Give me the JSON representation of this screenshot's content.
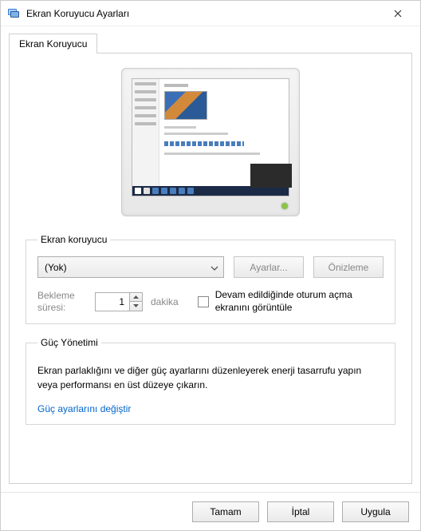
{
  "window": {
    "title": "Ekran Koruyucu Ayarları"
  },
  "tab": {
    "label": "Ekran Koruyucu"
  },
  "screensaver_group": {
    "legend": "Ekran koruyucu",
    "selected": "(Yok)",
    "settings_button": "Ayarlar...",
    "preview_button": "Önizleme"
  },
  "wait": {
    "label": "Bekleme süresi:",
    "value": "1",
    "unit": "dakika",
    "resume_label": "Devam edildiğinde oturum açma ekranını görüntüle"
  },
  "power_group": {
    "legend": "Güç Yönetimi",
    "description": "Ekran parlaklığını ve diğer güç ayarlarını düzenleyerek enerji tasarrufu yapın veya performansı en üst düzeye çıkarın.",
    "link": "Güç ayarlarını değiştir"
  },
  "footer": {
    "ok": "Tamam",
    "cancel": "İptal",
    "apply": "Uygula"
  }
}
